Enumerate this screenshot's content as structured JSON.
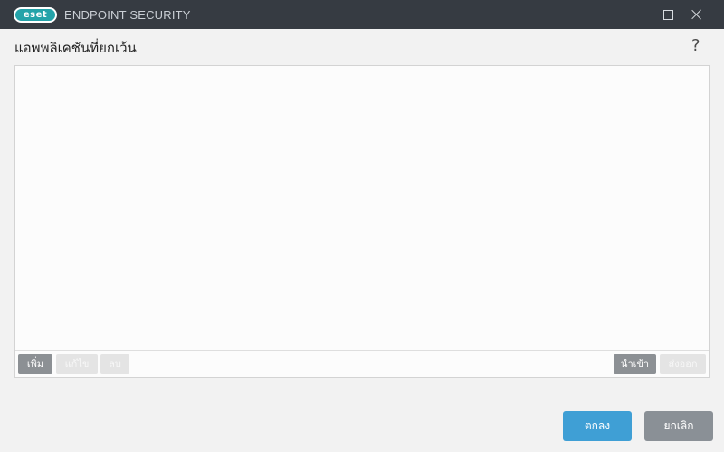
{
  "window": {
    "logo_text": "eset",
    "product": "ENDPOINT SECURITY"
  },
  "heading": "แอพพลิเคชันที่ยกเว้น",
  "help_label": "?",
  "toolbar": {
    "add": "เพิ่ม",
    "edit": "แก้ไข",
    "delete": "ลบ",
    "import": "นำเข้า",
    "export": "ส่งออก"
  },
  "footer": {
    "ok": "ตกลง",
    "cancel": "ยกเลิก"
  },
  "colors": {
    "titlebar": "#363b42",
    "accent": "#3f9fd5",
    "logo": "#24a3a9"
  },
  "icons": [
    "maximize-icon",
    "close-icon",
    "help-icon"
  ]
}
